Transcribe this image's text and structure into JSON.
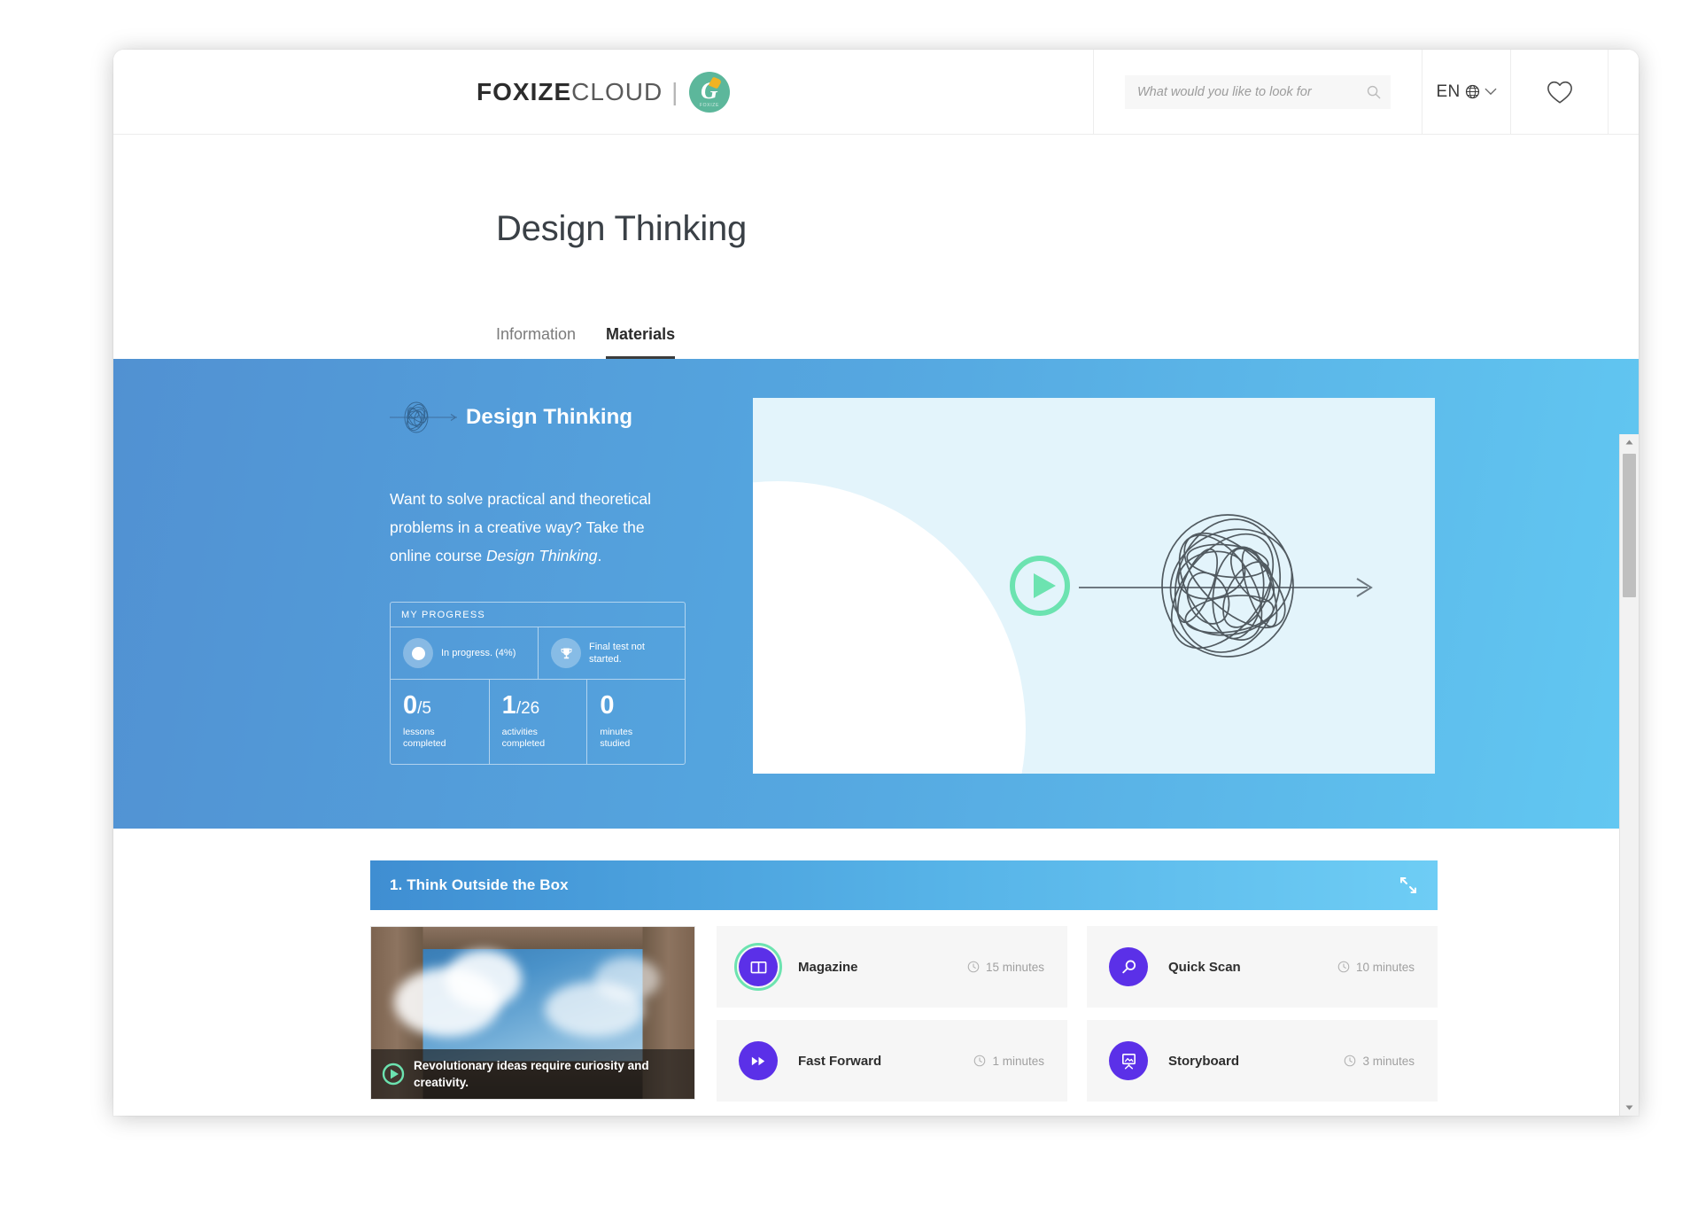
{
  "header": {
    "logo": {
      "bold": "FOXIZE",
      "light": "CLOUD",
      "separator": "|",
      "badge_letter": "G",
      "badge_sub": "FOXIZE"
    },
    "search": {
      "placeholder": "What would you like to look for",
      "value": "",
      "icon": "search-icon"
    },
    "language": {
      "label": "EN",
      "icon": "globe-icon",
      "chevron": "chevron-down-icon"
    },
    "favorites": {
      "icon": "heart-icon"
    }
  },
  "page": {
    "title": "Design Thinking",
    "tabs": [
      {
        "label": "Information",
        "active": false
      },
      {
        "label": "Materials",
        "active": true
      }
    ]
  },
  "hero": {
    "brand_title": "Design Thinking",
    "brand_icon": "tangle-scribble-icon",
    "description_part1": "Want to solve practical and theoretical problems in a creative way? Take the online course ",
    "description_italic": "Design Thinking",
    "description_end": ".",
    "progress": {
      "heading": "MY PROGRESS",
      "states": [
        {
          "icon": "progress-dot-icon",
          "label": "In progress. (4%)"
        },
        {
          "icon": "trophy-icon",
          "label": "Final test not started."
        }
      ],
      "stats": [
        {
          "value": "0",
          "denominator": "/5",
          "label_line1": "lessons",
          "label_line2": "completed"
        },
        {
          "value": "1",
          "denominator": "/26",
          "label_line1": "activities",
          "label_line2": "completed"
        },
        {
          "value": "0",
          "denominator": "",
          "label_line1": "minutes",
          "label_line2": "studied"
        }
      ]
    },
    "video": {
      "play_icon": "play-circle-icon",
      "illustration": "tangle-arrow-icon"
    }
  },
  "lesson": {
    "section_title": "1. Think Outside the Box",
    "collapse_icon": "collapse-arrows-icon",
    "thumbnail": {
      "caption": "Revolutionary ideas require curiosity and creativity.",
      "play_icon": "play-circle-icon",
      "image_alt": "looking-up-out-of-cardboard-box-at-sky"
    },
    "materials": [
      {
        "name": "Magazine",
        "icon": "open-book-icon",
        "duration": "15 minutes",
        "clock_icon": "clock-icon",
        "completed": true
      },
      {
        "name": "Quick Scan",
        "icon": "magnifier-icon",
        "duration": "10 minutes",
        "clock_icon": "clock-icon",
        "completed": false
      },
      {
        "name": "Fast Forward",
        "icon": "fast-forward-icon",
        "duration": "1 minutes",
        "clock_icon": "clock-icon",
        "completed": false
      },
      {
        "name": "Storyboard",
        "icon": "easel-picture-icon",
        "duration": "3 minutes",
        "clock_icon": "clock-icon",
        "completed": false
      }
    ]
  },
  "colors": {
    "accent_purple": "#5b30e8",
    "accent_mint": "#6ce3b0",
    "hero_blue_start": "#5191d2",
    "hero_blue_end": "#62c8f2",
    "video_panel": "#e3f4fb",
    "badge_green": "#5cb79b"
  }
}
